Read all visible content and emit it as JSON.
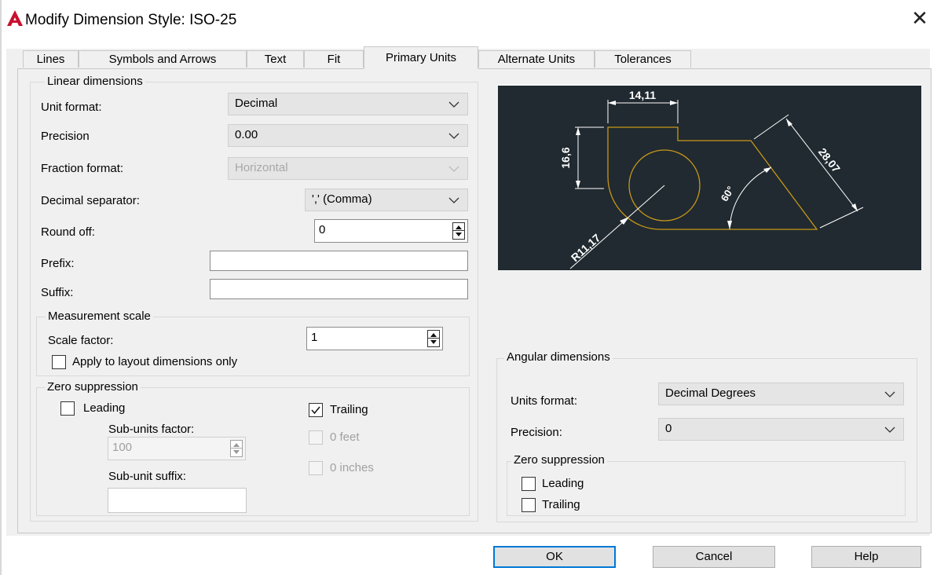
{
  "window": {
    "title": "Modify Dimension Style: ISO-25",
    "app_icon": "autocad-a-icon",
    "close_icon": "close-icon",
    "close_glyph": "✕"
  },
  "tabs": [
    {
      "label": "Lines"
    },
    {
      "label": "Symbols and Arrows"
    },
    {
      "label": "Text"
    },
    {
      "label": "Fit"
    },
    {
      "label": "Primary Units",
      "active": true
    },
    {
      "label": "Alternate Units"
    },
    {
      "label": "Tolerances"
    }
  ],
  "linear": {
    "legend": "Linear dimensions",
    "unit_format": {
      "label": "Unit format:",
      "value": "Decimal"
    },
    "precision": {
      "label": "Precision",
      "value": "0.00"
    },
    "fraction_format": {
      "label": "Fraction format:",
      "value": "Horizontal",
      "disabled": true
    },
    "decimal_separator": {
      "label": "Decimal separator:",
      "value": "',' (Comma)"
    },
    "round_off": {
      "label": "Round off:",
      "value": "0"
    },
    "prefix": {
      "label": "Prefix:",
      "value": ""
    },
    "suffix": {
      "label": "Suffix:",
      "value": ""
    }
  },
  "measurement": {
    "legend": "Measurement scale",
    "scale_factor": {
      "label": "Scale factor:",
      "value": "1"
    },
    "apply_layout": {
      "label": "Apply to layout dimensions only",
      "checked": false
    }
  },
  "zero_suppression": {
    "legend": "Zero suppression",
    "leading": {
      "label": "Leading",
      "checked": false
    },
    "trailing": {
      "label": "Trailing",
      "checked": true
    },
    "sub_units_factor": {
      "label": "Sub-units factor:",
      "value": "100"
    },
    "sub_unit_suffix": {
      "label": "Sub-unit suffix:",
      "value": ""
    },
    "zero_feet": {
      "label": "0 feet",
      "checked": false
    },
    "zero_inches": {
      "label": "0 inches",
      "checked": false
    }
  },
  "preview": {
    "background": "#202a30",
    "line_color": "#b8860b",
    "labels": {
      "width": "14,11",
      "height": "16,6",
      "diagonal": "28,07",
      "angle": "60°",
      "radius": "R11,17"
    }
  },
  "angular": {
    "legend": "Angular dimensions",
    "units_format": {
      "label": "Units format:",
      "value": "Decimal Degrees"
    },
    "precision": {
      "label": "Precision:",
      "value": "0"
    },
    "zero_suppression": {
      "legend": "Zero suppression",
      "leading": {
        "label": "Leading",
        "checked": false
      },
      "trailing": {
        "label": "Trailing",
        "checked": false
      }
    }
  },
  "buttons": {
    "ok": "OK",
    "cancel": "Cancel",
    "help": "Help"
  },
  "colors": {
    "accent": "#0078d7",
    "brand_icon": "#c8102e"
  }
}
